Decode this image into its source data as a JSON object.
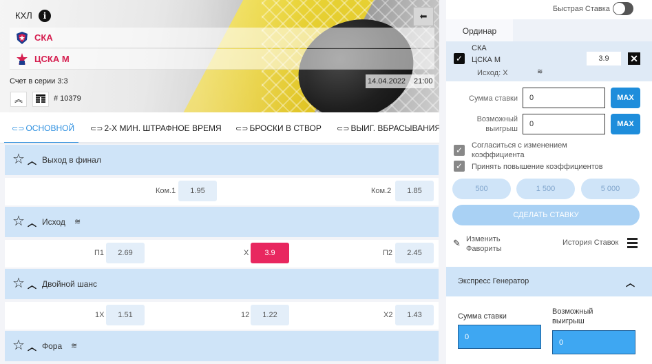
{
  "match": {
    "league": "КХЛ",
    "team1": "СКА",
    "team2": "ЦСКА М",
    "series_score": "Счет в серии 3:3",
    "date": "14.04.2022",
    "time": "21:00",
    "match_id": "# 10379"
  },
  "tabs": [
    {
      "label": "ОСНОВНОЙ",
      "active": true
    },
    {
      "label": "2-Х МИН. ШТРАФНОЕ ВРЕМЯ",
      "active": false
    },
    {
      "label": "БРОСКИ В СТВОР",
      "active": false
    },
    {
      "label": "ВЫИГ. ВБРАСЫВАНИЯ",
      "active": false
    }
  ],
  "markets": [
    {
      "title": "Выход в финал",
      "odds": [
        {
          "label": "Ком.1",
          "value": "1.95"
        },
        {
          "label": "Ком.2",
          "value": "1.85"
        }
      ]
    },
    {
      "title": "Исход",
      "odds": [
        {
          "label": "П1",
          "value": "2.69"
        },
        {
          "label": "Х",
          "value": "3.9",
          "selected": true
        },
        {
          "label": "П2",
          "value": "2.45"
        }
      ]
    },
    {
      "title": "Двойной шанс",
      "odds": [
        {
          "label": "1Х",
          "value": "1.51"
        },
        {
          "label": "12",
          "value": "1.22"
        },
        {
          "label": "Х2",
          "value": "1.43"
        }
      ]
    },
    {
      "title": "Фора",
      "odds": []
    }
  ],
  "slip": {
    "quick_bet_label": "Быстрая Ставка",
    "quick_bet_on": false,
    "tab": "Ординар",
    "bet": {
      "team1": "СКА",
      "team2": "ЦСКА М",
      "selection": "Исход: Х",
      "odd": "3.9"
    },
    "stake_label": "Сумма ставки",
    "stake_value": "0",
    "win_label_1": "Возможный",
    "win_label_2": "выигрыш",
    "win_value": "0",
    "max_label": "MAX",
    "agree1_line1": "Согласиться с изменением",
    "agree1_line2": "коэффициента",
    "agree2": "Принять повышение коэффициентов",
    "chips": [
      "500",
      "1 500",
      "5 000"
    ],
    "make_bet": "СДЕЛАТЬ СТАВКУ",
    "fav_line1": "Изменить",
    "fav_line2": "Фаворитs",
    "history": "История Ставок"
  },
  "express": {
    "title": "Экспресс Генератор",
    "stake_label": "Сумма ставки",
    "stake_value": "0",
    "win_label_1": "Возможный",
    "win_label_2": "выигрыш",
    "win_value": "0"
  },
  "colors": {
    "accent": "#2c8fe0",
    "selected_odd": "#e8275f",
    "team_name": "#d51e4f",
    "market_header": "#cfe4f8"
  }
}
